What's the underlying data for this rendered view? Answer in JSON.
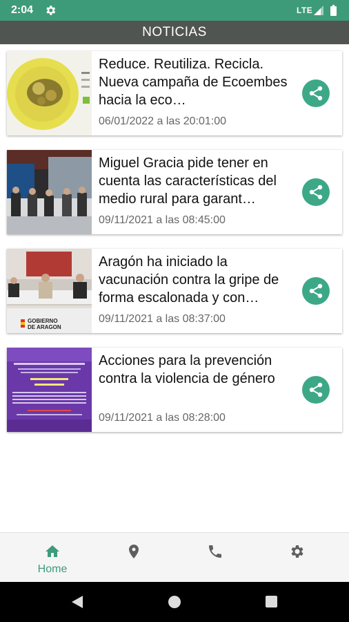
{
  "status_bar": {
    "time": "2:04",
    "network": "LTE",
    "icons": [
      "gear-icon",
      "signal-icon",
      "battery-icon"
    ]
  },
  "app_bar": {
    "title": "NOTICIAS"
  },
  "news": [
    {
      "headline": "Reduce. Reutiliza. Recicla. Nueva campaña de Ecoembes hacia la eco…",
      "date": "06/01/2022 a las 20:01:00"
    },
    {
      "headline": "Miguel Gracia pide tener en cuenta las características del medio rural para garant…",
      "date": "09/11/2021 a las 08:45:00"
    },
    {
      "headline": "Aragón ha iniciado la vacunación contra la gripe de forma escalonada y con…",
      "date": "09/11/2021 a las 08:37:00"
    },
    {
      "headline": "Acciones para la prevención contra la violencia de género",
      "date": "09/11/2021 a las 08:28:00"
    }
  ],
  "thumb_text": {
    "gobierno": "GOBIERNO",
    "aragon": "DE ARAGON"
  },
  "bottom_nav": {
    "home_label": "Home",
    "items": [
      "home-icon",
      "location-icon",
      "phone-icon",
      "settings-icon"
    ]
  },
  "colors": {
    "primary": "#3d9b7a",
    "app_bar": "#505552",
    "share": "#3da887"
  }
}
